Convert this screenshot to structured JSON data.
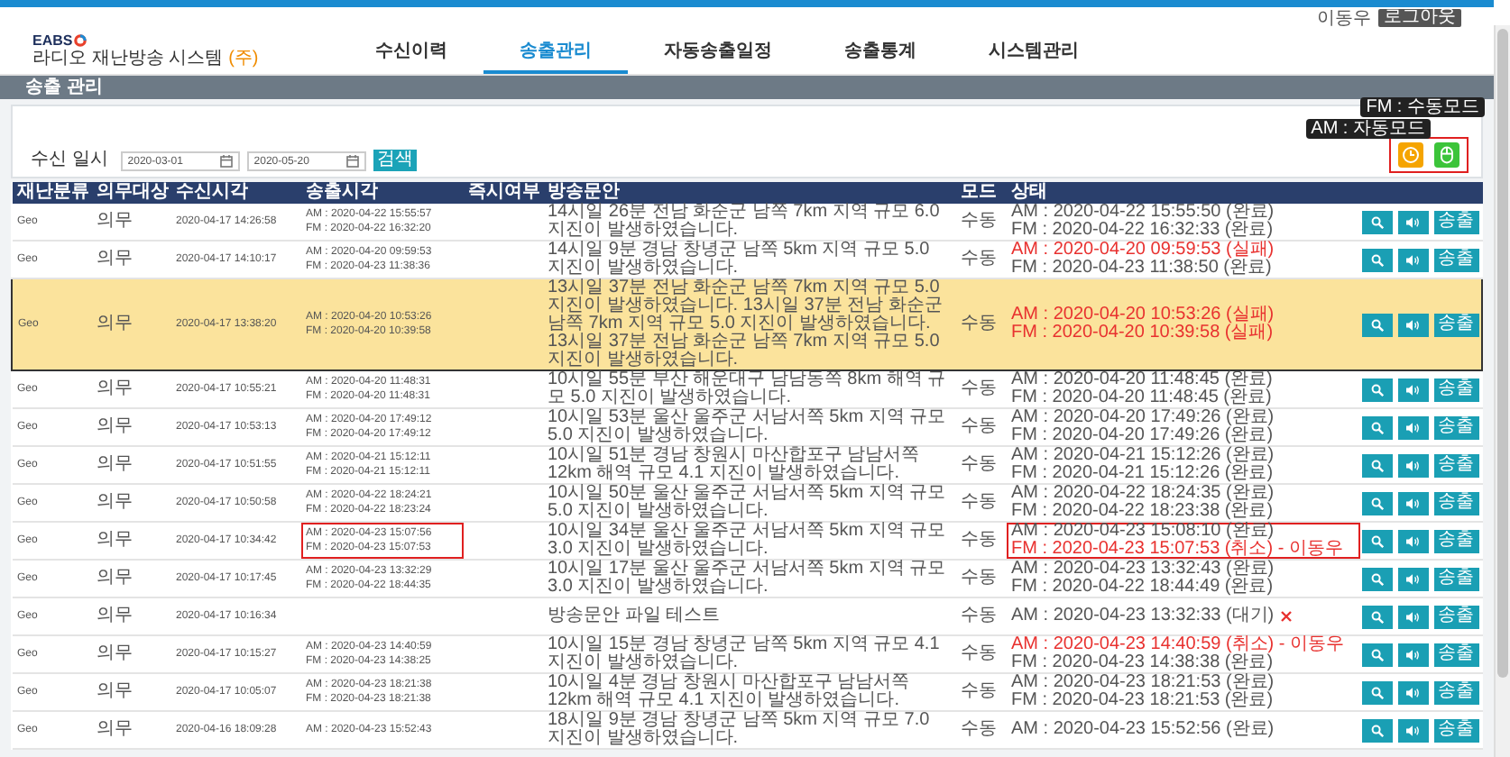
{
  "user_bar": {
    "user": "이동우",
    "logout": "로그아웃"
  },
  "header": {
    "logo": "EABS",
    "subtitle": "라디오 재난방송 시스템",
    "subtitle_tag": "(주)"
  },
  "nav": [
    {
      "label": "수신이력",
      "selected": false
    },
    {
      "label": "송출관리",
      "selected": true
    },
    {
      "label": "자동송출일정",
      "selected": false
    },
    {
      "label": "송출통계",
      "selected": false
    },
    {
      "label": "시스템관리",
      "selected": false
    }
  ],
  "page_title": "송출 관리",
  "search": {
    "label": "수신 일시",
    "date_from": "2020-03-01",
    "date_to": "2020-05-20",
    "button": "검색"
  },
  "mode_group": {
    "marked": true,
    "buttons": [
      {
        "kind": "clock",
        "tooltip": "AM : 자동모드",
        "color": "#f5a400"
      },
      {
        "kind": "mouse",
        "tooltip": "FM : 수동모드",
        "color": "#3cc43a"
      }
    ]
  },
  "table": {
    "columns": [
      "재난분류",
      "의무대상",
      "수신시각",
      "송출시각",
      "즉시여부",
      "방송문안",
      "모드",
      "상태"
    ],
    "rows": [
      {
        "category": "Geo",
        "target": "의무",
        "received": "2020-04-17 14:26:58",
        "sent": [
          "AM : 2020-04-22 15:55:57",
          "FM : 2020-04-22 16:32:20"
        ],
        "message": "14시일 26분 전남 화순군 남쪽 7km 지역 규모 6.0 지진이 발생하였습니다.",
        "mode": "수동",
        "status": [
          {
            "text": "AM : 2020-04-22 15:55:50 (완료)",
            "alert": false
          },
          {
            "text": "FM : 2020-04-22 16:32:33 (완료)",
            "alert": false
          }
        ],
        "cancel_icon": false,
        "send_button": "송출",
        "selected": false,
        "marked": false
      },
      {
        "category": "Geo",
        "target": "의무",
        "received": "2020-04-17 14:10:17",
        "sent": [
          "AM : 2020-04-20 09:59:53",
          "FM : 2020-04-23 11:38:36"
        ],
        "message": "14시일 9분 경남 창녕군 남쪽 5km 지역 규모 5.0 지진이 발생하였습니다.",
        "mode": "수동",
        "status": [
          {
            "text": "AM : 2020-04-20 09:59:53 (실패)",
            "alert": true
          },
          {
            "text": "FM : 2020-04-23 11:38:50 (완료)",
            "alert": false
          }
        ],
        "cancel_icon": false,
        "send_button": "송출",
        "selected": false,
        "marked": false
      },
      {
        "category": "Geo",
        "target": "의무",
        "received": "2020-04-17 13:38:20",
        "sent": [
          "AM : 2020-04-20 10:53:26",
          "FM : 2020-04-20 10:39:58"
        ],
        "message": "13시일 37분 전남 화순군 남쪽 7km 지역 규모 5.0 지진이 발생하였습니다. 13시일 37분 전남 화순군 남쪽 7km 지역 규모 5.0 지진이 발생하였습니다. 13시일 37분 전남 화순군 남쪽 7km 지역 규모 5.0 지진이 발생하였습니다.",
        "mode": "수동",
        "status": [
          {
            "text": "AM : 2020-04-20 10:53:26 (실패)",
            "alert": true
          },
          {
            "text": "FM : 2020-04-20 10:39:58 (실패)",
            "alert": true
          }
        ],
        "cancel_icon": false,
        "send_button": "송출",
        "selected": true,
        "marked": false
      },
      {
        "category": "Geo",
        "target": "의무",
        "received": "2020-04-17 10:55:21",
        "sent": [
          "AM : 2020-04-20 11:48:31",
          "FM : 2020-04-20 11:48:31"
        ],
        "message": "10시일 55분 부산 해운대구 남남동쪽 8km 해역 규모 5.0 지진이 발생하였습니다.",
        "mode": "수동",
        "status": [
          {
            "text": "AM : 2020-04-20 11:48:45 (완료)",
            "alert": false
          },
          {
            "text": "FM : 2020-04-20 11:48:45 (완료)",
            "alert": false
          }
        ],
        "cancel_icon": false,
        "send_button": "송출",
        "selected": false,
        "marked": false
      },
      {
        "category": "Geo",
        "target": "의무",
        "received": "2020-04-17 10:53:13",
        "sent": [
          "AM : 2020-04-20 17:49:12",
          "FM : 2020-04-20 17:49:12"
        ],
        "message": "10시일 53분 울산 울주군 서남서쪽 5km 지역 규모 5.0 지진이 발생하였습니다.",
        "mode": "수동",
        "status": [
          {
            "text": "AM : 2020-04-20 17:49:26 (완료)",
            "alert": false
          },
          {
            "text": "FM : 2020-04-20 17:49:26 (완료)",
            "alert": false
          }
        ],
        "cancel_icon": false,
        "send_button": "송출",
        "selected": false,
        "marked": false
      },
      {
        "category": "Geo",
        "target": "의무",
        "received": "2020-04-17 10:51:55",
        "sent": [
          "AM : 2020-04-21 15:12:11",
          "FM : 2020-04-21 15:12:11"
        ],
        "message": "10시일 51분 경남 창원시 마산합포구 남남서쪽 12km 해역 규모 4.1 지진이 발생하였습니다.",
        "mode": "수동",
        "status": [
          {
            "text": "AM : 2020-04-21 15:12:26 (완료)",
            "alert": false
          },
          {
            "text": "FM : 2020-04-21 15:12:26 (완료)",
            "alert": false
          }
        ],
        "cancel_icon": false,
        "send_button": "송출",
        "selected": false,
        "marked": false
      },
      {
        "category": "Geo",
        "target": "의무",
        "received": "2020-04-17 10:50:58",
        "sent": [
          "AM : 2020-04-22 18:24:21",
          "FM : 2020-04-22 18:23:24"
        ],
        "message": "10시일 50분 울산 울주군 서남서쪽 5km 지역 규모 5.0 지진이 발생하였습니다.",
        "mode": "수동",
        "status": [
          {
            "text": "AM : 2020-04-22 18:24:35 (완료)",
            "alert": false
          },
          {
            "text": "FM : 2020-04-22 18:23:38 (완료)",
            "alert": false
          }
        ],
        "cancel_icon": false,
        "send_button": "송출",
        "selected": false,
        "marked": false
      },
      {
        "category": "Geo",
        "target": "의무",
        "received": "2020-04-17 10:34:42",
        "sent": [
          "AM : 2020-04-23 15:07:56",
          "FM : 2020-04-23 15:07:53"
        ],
        "message": "10시일 34분 울산 울주군 서남서쪽 5km 지역 규모 3.0 지진이 발생하였습니다.",
        "mode": "수동",
        "status": [
          {
            "text": "AM : 2020-04-23 15:08:10 (완료)",
            "alert": false
          },
          {
            "text": "FM : 2020-04-23 15:07:53 (취소) - 이동우",
            "alert": true
          }
        ],
        "cancel_icon": false,
        "send_button": "송출",
        "selected": false,
        "marked": true
      },
      {
        "category": "Geo",
        "target": "의무",
        "received": "2020-04-17 10:17:45",
        "sent": [
          "AM : 2020-04-23 13:32:29",
          "FM : 2020-04-22 18:44:35"
        ],
        "message": "10시일 17분 울산 울주군 서남서쪽 5km 지역 규모 3.0 지진이 발생하였습니다.",
        "mode": "수동",
        "status": [
          {
            "text": "AM : 2020-04-23 13:32:43 (완료)",
            "alert": false
          },
          {
            "text": "FM : 2020-04-22 18:44:49 (완료)",
            "alert": false
          }
        ],
        "cancel_icon": false,
        "send_button": "송출",
        "selected": false,
        "marked": false
      },
      {
        "category": "Geo",
        "target": "의무",
        "received": "2020-04-17 10:16:34",
        "message": "방송문안 파일 테스트",
        "mode": "수동",
        "status": [
          {
            "text": "AM : 2020-04-23 13:32:33 (대기)",
            "alert": false
          }
        ],
        "cancel_icon": true,
        "send_button": "송출",
        "selected": false,
        "marked": false
      },
      {
        "category": "Geo",
        "target": "의무",
        "received": "2020-04-17 10:15:27",
        "sent": [
          "AM : 2020-04-23 14:40:59",
          "FM : 2020-04-23 14:38:25"
        ],
        "message": "10시일 15분 경남 창녕군 남쪽 5km 지역 규모 4.1 지진이 발생하였습니다.",
        "mode": "수동",
        "status": [
          {
            "text": "AM : 2020-04-23 14:40:59 (취소) - 이동우",
            "alert": true
          },
          {
            "text": "FM : 2020-04-23 14:38:38 (완료)",
            "alert": false
          }
        ],
        "cancel_icon": false,
        "send_button": "송출",
        "selected": false,
        "marked": false
      },
      {
        "category": "Geo",
        "target": "의무",
        "received": "2020-04-17 10:05:07",
        "sent": [
          "AM : 2020-04-23 18:21:38",
          "FM : 2020-04-23 18:21:38"
        ],
        "message": "10시일 4분 경남 창원시 마산합포구 남남서쪽 12km 해역 규모 4.1 지진이 발생하였습니다.",
        "mode": "수동",
        "status": [
          {
            "text": "AM : 2020-04-23 18:21:53 (완료)",
            "alert": false
          },
          {
            "text": "FM : 2020-04-23 18:21:53 (완료)",
            "alert": false
          }
        ],
        "cancel_icon": false,
        "send_button": "송출",
        "selected": false,
        "marked": false
      },
      {
        "category": "Geo",
        "target": "의무",
        "received": "2020-04-16 18:09:28",
        "sent": [
          "AM : 2020-04-23 15:52:43"
        ],
        "message": "18시일 9분 경남 창녕군 남쪽 5km 지역 규모 7.0 지진이 발생하였습니다.",
        "mode": "수동",
        "status": [
          {
            "text": "AM : 2020-04-23 15:52:56 (완료)",
            "alert": false
          }
        ],
        "cancel_icon": false,
        "send_button": "송출",
        "selected": false,
        "marked": false
      }
    ]
  }
}
